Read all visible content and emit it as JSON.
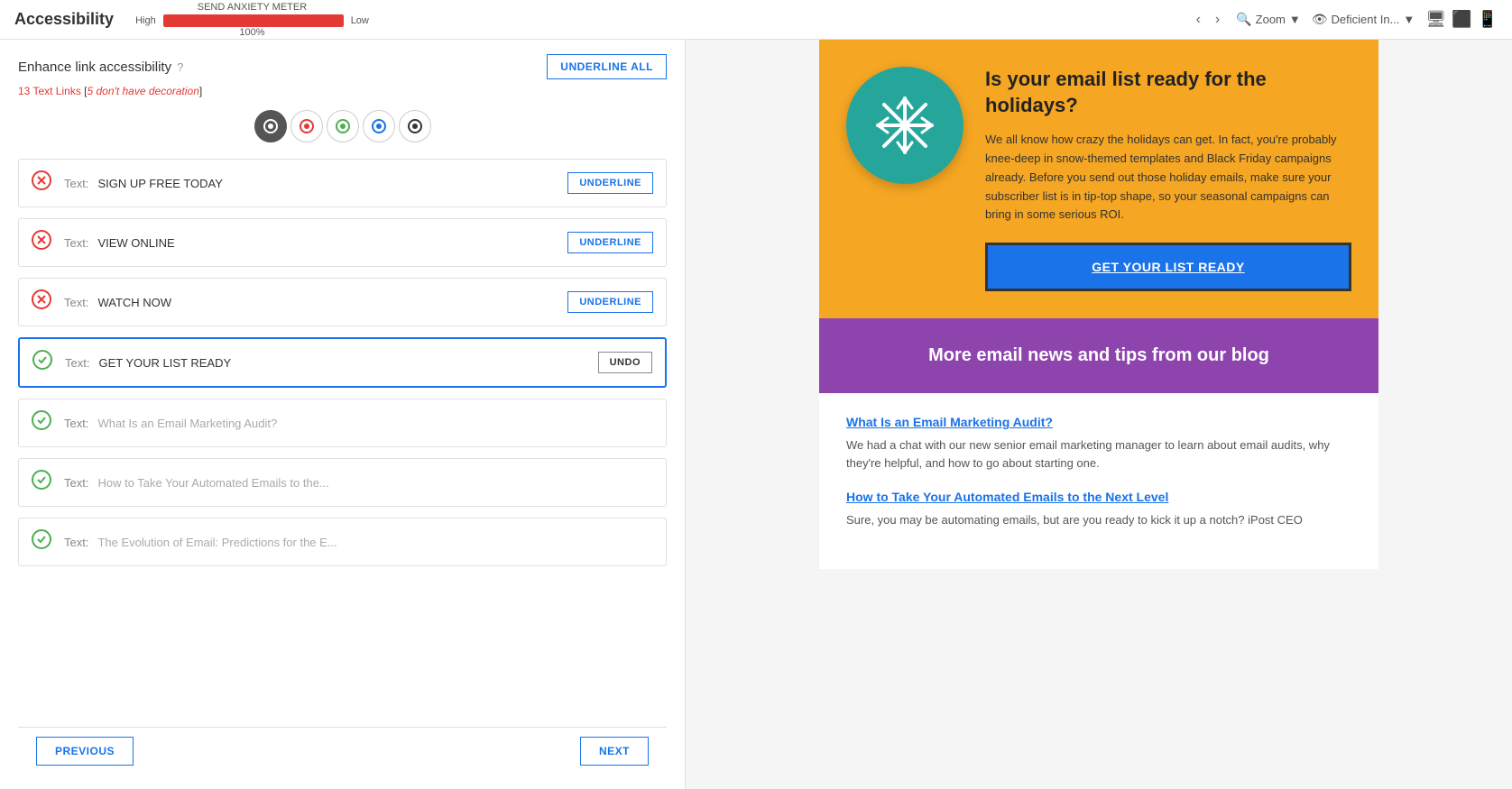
{
  "topBar": {
    "title": "Accessibility",
    "meter": {
      "label": "SEND ANXIETY METER",
      "high": "High",
      "low": "Low",
      "percent": "100%",
      "barWidth": "100"
    },
    "nav": {
      "left_arrow": "‹",
      "right_arrow": "›"
    },
    "zoom": {
      "label": "Zoom",
      "icon": "🔍"
    },
    "deficient": {
      "label": "Deficient In...",
      "icon": "👁"
    },
    "viewIcons": [
      "🖥",
      "⬜",
      "📱"
    ]
  },
  "leftPanel": {
    "title": "Enhance link accessibility",
    "helpIcon": "?",
    "underlineAllLabel": "UNDERLINE ALL",
    "linkCount": "13 Text Links",
    "linkCountWarning": "5 don't have decoration",
    "filterIcons": [
      {
        "id": "filter-all",
        "label": "Ⓐ",
        "active": true
      },
      {
        "id": "filter-red",
        "label": "◉",
        "active": false
      },
      {
        "id": "filter-green",
        "label": "◉",
        "active": false
      },
      {
        "id": "filter-blue",
        "label": "◉",
        "active": false
      },
      {
        "id": "filter-dark",
        "label": "◉",
        "active": false
      }
    ],
    "links": [
      {
        "id": "link-1",
        "status": "error",
        "label": "Text:",
        "text": "SIGN UP FREE TODAY",
        "action": "UNDERLINE",
        "selected": false
      },
      {
        "id": "link-2",
        "status": "error",
        "label": "Text:",
        "text": "VIEW ONLINE",
        "action": "UNDERLINE",
        "selected": false
      },
      {
        "id": "link-3",
        "status": "error",
        "label": "Text:",
        "text": "WATCH NOW",
        "action": "UNDERLINE",
        "selected": false
      },
      {
        "id": "link-4",
        "status": "success",
        "label": "Text:",
        "text": "GET YOUR LIST READY",
        "action": "UNDO",
        "selected": true
      },
      {
        "id": "link-5",
        "status": "success",
        "label": "Text:",
        "text": "What Is an Email Marketing Audit?",
        "action": null,
        "selected": false,
        "dimmed": true
      },
      {
        "id": "link-6",
        "status": "success",
        "label": "Text:",
        "text": "How to Take Your Automated Emails to the...",
        "action": null,
        "selected": false,
        "dimmed": true
      },
      {
        "id": "link-7",
        "status": "success",
        "label": "Text:",
        "text": "The Evolution of Email: Predictions for the E...",
        "action": null,
        "selected": false,
        "dimmed": true
      }
    ],
    "prevLabel": "PREVIOUS",
    "nextLabel": "NEXT"
  },
  "rightPanel": {
    "orangeSection": {
      "headline": "Is your email list ready for the holidays?",
      "body": "We all know how crazy the holidays can get. In fact, you're probably knee-deep in snow-themed templates and Black Friday campaigns already. Before you send out those holiday emails, make sure your subscriber list is in tip-top shape, so your seasonal campaigns can bring in some serious ROI.",
      "ctaLabel": "GET YOUR LIST READY"
    },
    "purpleSection": {
      "headline": "More email news and tips from our blog"
    },
    "blogSection": {
      "links": [
        {
          "linkText": "What Is an Email Marketing Audit?",
          "description": "We had a chat with our new senior email marketing manager to learn about email audits, why they're helpful, and how to go about starting one."
        },
        {
          "linkText": "How to Take Your Automated Emails to the Next Level",
          "description": "Sure, you may be automating emails, but are you ready to kick it up a notch? iPost CEO"
        }
      ]
    }
  }
}
